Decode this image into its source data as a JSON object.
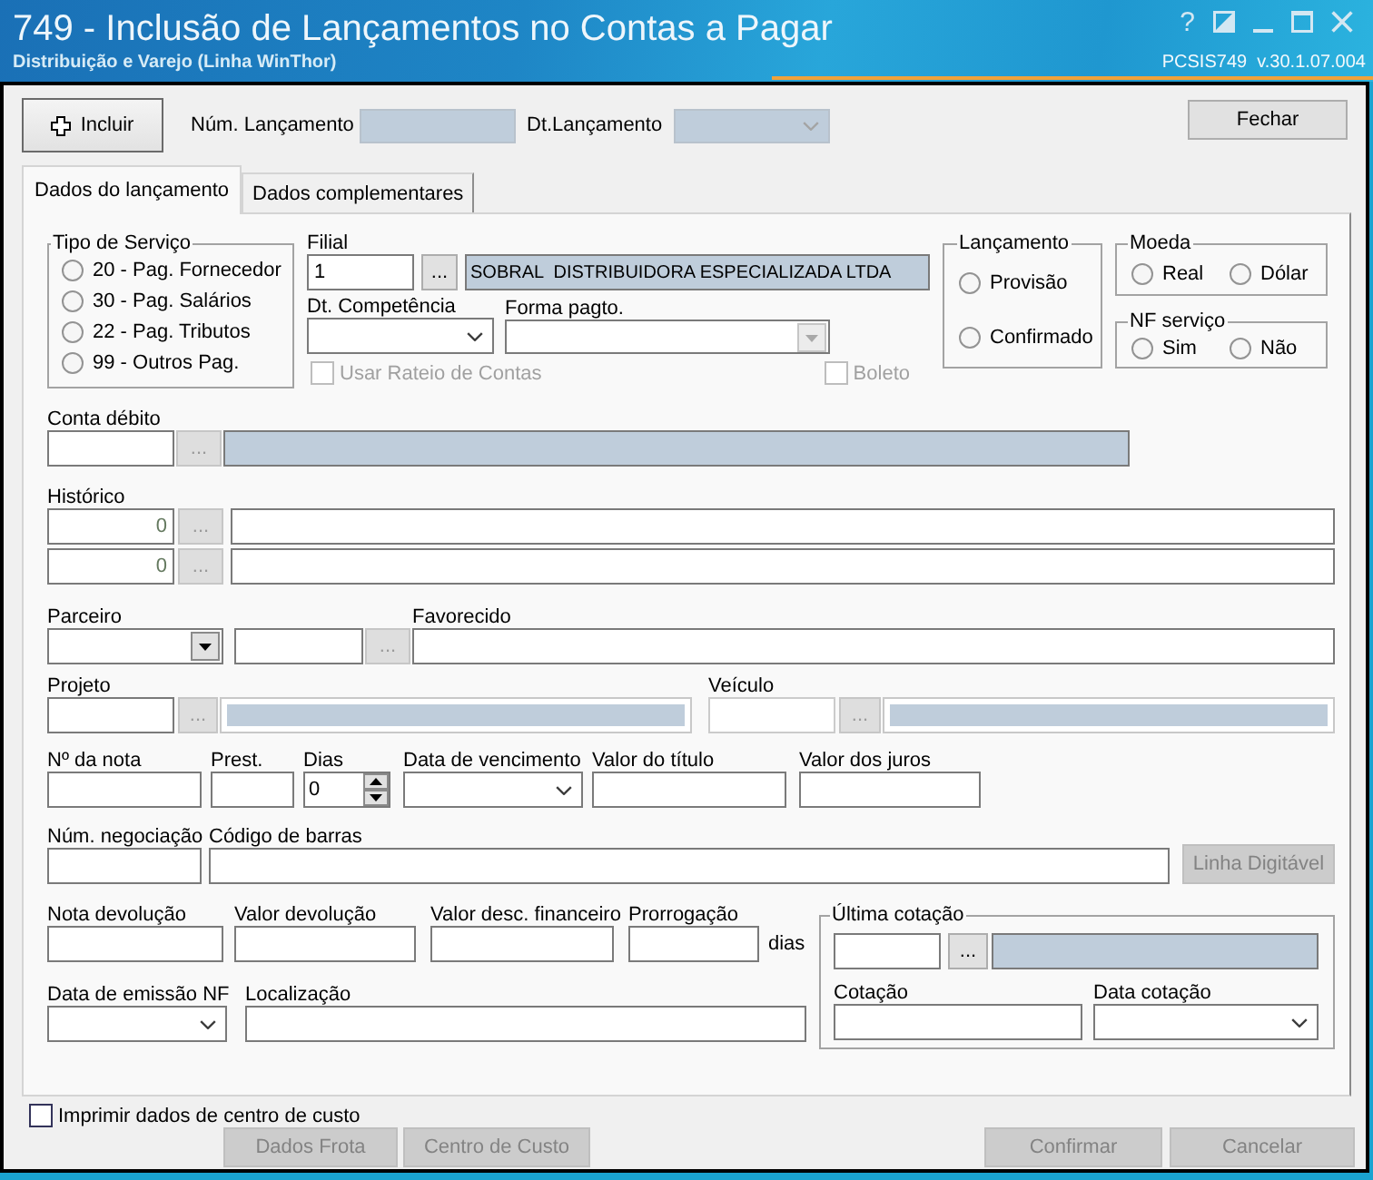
{
  "window": {
    "title": "749 - Inclusão de Lançamentos no Contas a Pagar",
    "subtitle": "Distribuição e Varejo (Linha WinThor)",
    "version": "PCSIS749  v.30.1.07.004",
    "controls": [
      {
        "kind": "help",
        "label": "?"
      },
      {
        "kind": "theme"
      },
      {
        "kind": "minimize"
      },
      {
        "kind": "maximize"
      },
      {
        "kind": "close"
      }
    ]
  },
  "toolbar": {
    "add_button": {
      "label": "Incluir"
    },
    "fields": [
      {
        "kind": "text",
        "caption": "Núm. Lançamento",
        "readonly": true
      },
      {
        "kind": "date",
        "caption": "Dt.Lançamento",
        "disabled": true
      }
    ],
    "close_button": {
      "label": "Fechar"
    }
  },
  "tabs": [
    {
      "label": "Dados do lançamento",
      "selected": true
    },
    {
      "label": "Dados complementares",
      "selected": false
    }
  ],
  "service_type": {
    "title": "Tipo de Serviço",
    "options": [
      {
        "label": "20 - Pag. Fornecedor",
        "selected": false
      },
      {
        "label": "30 - Pag. Salários",
        "selected": false
      },
      {
        "label": "22 - Pag. Tributos",
        "selected": false
      },
      {
        "label": "99 - Outros Pag.",
        "selected": false
      }
    ]
  },
  "filial": [
    {
      "kind": "text",
      "caption": "Filial",
      "value": "1"
    },
    {
      "kind": "browse",
      "label": "...",
      "disabled": false
    },
    {
      "kind": "text",
      "readonly": true,
      "value": "SOBRAL  DISTRIBUIDORA ESPECIALIZADA LTDA"
    }
  ],
  "payment": [
    {
      "kind": "date",
      "caption": "Dt. Competência"
    },
    {
      "kind": "dropdown",
      "caption": "Forma pagto.",
      "disabled": true
    }
  ],
  "options": [
    {
      "label": "Usar Rateio de Contas",
      "checked": false,
      "disabled": true
    },
    {
      "label": "Boleto",
      "checked": false,
      "disabled": true
    }
  ],
  "lancamento": {
    "title": "Lançamento",
    "options": [
      {
        "label": "Provisão",
        "selected": false
      },
      {
        "label": "Confirmado",
        "selected": false
      }
    ]
  },
  "moeda": {
    "title": "Moeda",
    "options": [
      {
        "label": "Real",
        "selected": false
      },
      {
        "label": "Dólar",
        "selected": false
      }
    ]
  },
  "nf_servico": {
    "title": "NF serviço",
    "options": [
      {
        "label": "Sim",
        "selected": false
      },
      {
        "label": "Não",
        "selected": false
      }
    ]
  },
  "rows": [
    [
      {
        "kind": "text",
        "caption": "Conta débito"
      },
      {
        "kind": "browse",
        "label": "...",
        "disabled": true
      },
      {
        "kind": "text",
        "readonly": true
      }
    ],
    [
      {
        "kind": "text",
        "caption": "Histórico",
        "value": "0"
      },
      {
        "kind": "browse",
        "label": "...",
        "disabled": true
      },
      {
        "kind": "text"
      }
    ],
    [
      {
        "kind": "text",
        "value": "0"
      },
      {
        "kind": "browse",
        "label": "...",
        "disabled": true
      },
      {
        "kind": "text"
      }
    ],
    [
      {
        "kind": "dropdown",
        "caption": "Parceiro",
        "disabled": false
      },
      {
        "kind": "text"
      },
      {
        "kind": "browse",
        "label": "...",
        "disabled": true
      },
      {
        "kind": "text",
        "caption": "Favorecido"
      }
    ],
    [
      {
        "kind": "text",
        "caption": "Projeto"
      },
      {
        "kind": "browse",
        "label": "...",
        "disabled": true
      },
      {
        "kind": "display"
      },
      {
        "kind": "text",
        "caption": "Veículo",
        "disabled": true
      },
      {
        "kind": "browse",
        "label": "...",
        "disabled": true
      },
      {
        "kind": "display"
      }
    ],
    [
      {
        "kind": "text",
        "caption": "Nº da nota"
      },
      {
        "kind": "text",
        "caption": "Prest."
      },
      {
        "kind": "spin",
        "caption": "Dias",
        "value": "0"
      },
      {
        "kind": "date",
        "caption": "Data de vencimento"
      },
      {
        "kind": "text",
        "caption": "Valor do título"
      },
      {
        "kind": "text",
        "caption": "Valor dos juros"
      }
    ],
    [
      {
        "kind": "text",
        "caption": "Núm. negociação"
      },
      {
        "kind": "text",
        "caption": "Código de barras"
      },
      {
        "kind": "button",
        "label": "Linha Digitável",
        "disabled": true
      }
    ]
  ],
  "lower_rows": [
    [
      {
        "kind": "text",
        "caption": "Nota devolução"
      },
      {
        "kind": "text",
        "caption": "Valor devolução"
      },
      {
        "kind": "text",
        "caption": "Valor desc. financeiro"
      },
      {
        "kind": "text",
        "caption": "Prorrogação"
      },
      {
        "kind": "unit",
        "label": "dias"
      }
    ],
    [
      {
        "kind": "date",
        "caption": "Data de emissão NF"
      },
      {
        "kind": "text",
        "caption": "Localização"
      }
    ]
  ],
  "last_quote": {
    "title": "Última cotação",
    "rows": [
      [
        {
          "kind": "text"
        },
        {
          "kind": "browse",
          "label": "...",
          "disabled": false
        },
        {
          "kind": "text",
          "readonly": true
        }
      ],
      [
        {
          "kind": "text",
          "caption": "Cotação"
        },
        {
          "kind": "date",
          "caption": "Data cotação"
        }
      ]
    ]
  },
  "footer": {
    "checkbox": {
      "label": "Imprimir dados de centro de custo",
      "checked": false,
      "disabled": false
    },
    "buttons": [
      {
        "label": "Dados Frota",
        "disabled": true
      },
      {
        "label": "Centro de Custo",
        "disabled": true
      },
      {
        "label": "Confirmar",
        "disabled": true
      },
      {
        "label": "Cancelar",
        "disabled": true
      }
    ]
  }
}
